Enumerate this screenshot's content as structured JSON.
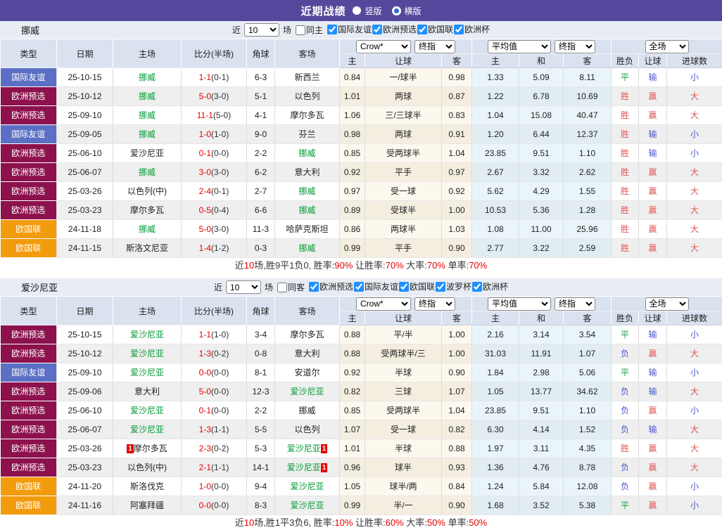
{
  "title_bar": {
    "title": "近期战绩",
    "radio_vertical": "竖版",
    "radio_horizontal": "横版"
  },
  "table_header": {
    "cols": [
      "类型",
      "日期",
      "主场",
      "比分(半场)",
      "角球",
      "客场"
    ],
    "sub": [
      "主",
      "让球",
      "客",
      "主",
      "和",
      "客",
      "胜负",
      "让球",
      "进球数"
    ],
    "selects": {
      "crow": "Crow*",
      "final": "终指",
      "avg": "平均值",
      "full": "全场"
    }
  },
  "type_colors": {
    "国际友谊": "#5b70c4",
    "欧洲预选": "#8c114d",
    "欧国联": "#f29b0d"
  },
  "result_colors": {
    "胜": "#e25555",
    "平": "#18a045",
    "负": "#4a55cc",
    "赢": "#e25555",
    "输": "#4a55cc",
    "大": "#e25555",
    "小": "#4a55cc"
  },
  "sections": [
    {
      "team": "挪威",
      "filter": {
        "near": "近",
        "count": "10",
        "games": "场",
        "same": "同主",
        "leagues": [
          "国际友谊",
          "欧洲预选",
          "欧国联",
          "欧洲杯"
        ]
      },
      "rows": [
        {
          "type": "国际友谊",
          "date": "25-10-15",
          "home": "挪威",
          "home_rc": "",
          "score": "1-1",
          "half": "(0-1)",
          "corner": "6-3",
          "away": "新西兰",
          "away_rc": "",
          "odds": [
            "0.84",
            "一/球半",
            "0.98"
          ],
          "avg": [
            "1.33",
            "5.09",
            "8.11"
          ],
          "res": [
            "平",
            "输",
            "小"
          ]
        },
        {
          "type": "欧洲预选",
          "date": "25-10-12",
          "home": "挪威",
          "home_rc": "",
          "score": "5-0",
          "half": "(3-0)",
          "corner": "5-1",
          "away": "以色列",
          "away_rc": "",
          "odds": [
            "1.01",
            "两球",
            "0.87"
          ],
          "avg": [
            "1.22",
            "6.78",
            "10.69"
          ],
          "res": [
            "胜",
            "赢",
            "大"
          ]
        },
        {
          "type": "欧洲预选",
          "date": "25-09-10",
          "home": "挪威",
          "home_rc": "",
          "score": "11-1",
          "half": "(5-0)",
          "corner": "4-1",
          "away": "摩尔多瓦",
          "away_rc": "",
          "odds": [
            "1.06",
            "三/三球半",
            "0.83"
          ],
          "avg": [
            "1.04",
            "15.08",
            "40.47"
          ],
          "res": [
            "胜",
            "赢",
            "大"
          ]
        },
        {
          "type": "国际友谊",
          "date": "25-09-05",
          "home": "挪威",
          "home_rc": "",
          "score": "1-0",
          "half": "(1-0)",
          "corner": "9-0",
          "away": "芬兰",
          "away_rc": "",
          "odds": [
            "0.98",
            "两球",
            "0.91"
          ],
          "avg": [
            "1.20",
            "6.44",
            "12.37"
          ],
          "res": [
            "胜",
            "输",
            "小"
          ]
        },
        {
          "type": "欧洲预选",
          "date": "25-06-10",
          "home": "爱沙尼亚",
          "home_rc": "",
          "score": "0-1",
          "half": "(0-0)",
          "corner": "2-2",
          "away": "挪威",
          "away_rc": "",
          "odds": [
            "0.85",
            "受两球半",
            "1.04"
          ],
          "avg": [
            "23.85",
            "9.51",
            "1.10"
          ],
          "res": [
            "胜",
            "输",
            "小"
          ]
        },
        {
          "type": "欧洲预选",
          "date": "25-06-07",
          "home": "挪威",
          "home_rc": "",
          "score": "3-0",
          "half": "(3-0)",
          "corner": "6-2",
          "away": "意大利",
          "away_rc": "",
          "odds": [
            "0.92",
            "平手",
            "0.97"
          ],
          "avg": [
            "2.67",
            "3.32",
            "2.62"
          ],
          "res": [
            "胜",
            "赢",
            "大"
          ]
        },
        {
          "type": "欧洲预选",
          "date": "25-03-26",
          "home": "以色列(中)",
          "home_rc": "",
          "score": "2-4",
          "half": "(0-1)",
          "corner": "2-7",
          "away": "挪威",
          "away_rc": "",
          "odds": [
            "0.97",
            "受一球",
            "0.92"
          ],
          "avg": [
            "5.62",
            "4.29",
            "1.55"
          ],
          "res": [
            "胜",
            "赢",
            "大"
          ]
        },
        {
          "type": "欧洲预选",
          "date": "25-03-23",
          "home": "摩尔多瓦",
          "home_rc": "",
          "score": "0-5",
          "half": "(0-4)",
          "corner": "6-6",
          "away": "挪威",
          "away_rc": "",
          "odds": [
            "0.89",
            "受球半",
            "1.00"
          ],
          "avg": [
            "10.53",
            "5.36",
            "1.28"
          ],
          "res": [
            "胜",
            "赢",
            "大"
          ]
        },
        {
          "type": "欧国联",
          "date": "24-11-18",
          "home": "挪威",
          "home_rc": "",
          "score": "5-0",
          "half": "(3-0)",
          "corner": "11-3",
          "away": "哈萨克斯坦",
          "away_rc": "",
          "odds": [
            "0.86",
            "两球半",
            "1.03"
          ],
          "avg": [
            "1.08",
            "11.00",
            "25.96"
          ],
          "res": [
            "胜",
            "赢",
            "大"
          ]
        },
        {
          "type": "欧国联",
          "date": "24-11-15",
          "home": "斯洛文尼亚",
          "home_rc": "",
          "score": "1-4",
          "half": "(1-2)",
          "corner": "0-3",
          "away": "挪威",
          "away_rc": "",
          "odds": [
            "0.99",
            "平手",
            "0.90"
          ],
          "avg": [
            "2.77",
            "3.22",
            "2.59"
          ],
          "res": [
            "胜",
            "赢",
            "大"
          ]
        }
      ],
      "summary": [
        {
          "t": "近"
        },
        {
          "t": "10",
          "red": true
        },
        {
          "t": "场,胜9平1负0, 胜率:"
        },
        {
          "t": "90%",
          "red": true
        },
        {
          "t": " 让胜率:"
        },
        {
          "t": "70%",
          "red": true
        },
        {
          "t": " 大率:"
        },
        {
          "t": "70%",
          "red": true
        },
        {
          "t": " 单率:"
        },
        {
          "t": "70%",
          "red": true
        }
      ]
    },
    {
      "team": "爱沙尼亚",
      "filter": {
        "near": "近",
        "count": "10",
        "games": "场",
        "same": "同客",
        "leagues": [
          "欧洲预选",
          "国际友谊",
          "欧国联",
          "波罗杯",
          "欧洲杯"
        ]
      },
      "rows": [
        {
          "type": "欧洲预选",
          "date": "25-10-15",
          "home": "爱沙尼亚",
          "home_rc": "",
          "score": "1-1",
          "half": "(1-0)",
          "corner": "3-4",
          "away": "摩尔多瓦",
          "away_rc": "",
          "odds": [
            "0.88",
            "平/半",
            "1.00"
          ],
          "avg": [
            "2.16",
            "3.14",
            "3.54"
          ],
          "res": [
            "平",
            "输",
            "小"
          ]
        },
        {
          "type": "欧洲预选",
          "date": "25-10-12",
          "home": "爱沙尼亚",
          "home_rc": "",
          "score": "1-3",
          "half": "(0-2)",
          "corner": "0-8",
          "away": "意大利",
          "away_rc": "",
          "odds": [
            "0.88",
            "受两球半/三",
            "1.00"
          ],
          "avg": [
            "31.03",
            "11.91",
            "1.07"
          ],
          "res": [
            "负",
            "赢",
            "大"
          ]
        },
        {
          "type": "国际友谊",
          "date": "25-09-10",
          "home": "爱沙尼亚",
          "home_rc": "",
          "score": "0-0",
          "half": "(0-0)",
          "corner": "8-1",
          "away": "安道尔",
          "away_rc": "",
          "odds": [
            "0.92",
            "半球",
            "0.90"
          ],
          "avg": [
            "1.84",
            "2.98",
            "5.06"
          ],
          "res": [
            "平",
            "输",
            "小"
          ]
        },
        {
          "type": "欧洲预选",
          "date": "25-09-06",
          "home": "意大利",
          "home_rc": "",
          "score": "5-0",
          "half": "(0-0)",
          "corner": "12-3",
          "away": "爱沙尼亚",
          "away_rc": "",
          "odds": [
            "0.82",
            "三球",
            "1.07"
          ],
          "avg": [
            "1.05",
            "13.77",
            "34.62"
          ],
          "res": [
            "负",
            "输",
            "大"
          ]
        },
        {
          "type": "欧洲预选",
          "date": "25-06-10",
          "home": "爱沙尼亚",
          "home_rc": "",
          "score": "0-1",
          "half": "(0-0)",
          "corner": "2-2",
          "away": "挪威",
          "away_rc": "",
          "odds": [
            "0.85",
            "受两球半",
            "1.04"
          ],
          "avg": [
            "23.85",
            "9.51",
            "1.10"
          ],
          "res": [
            "负",
            "赢",
            "小"
          ]
        },
        {
          "type": "欧洲预选",
          "date": "25-06-07",
          "home": "爱沙尼亚",
          "home_rc": "",
          "score": "1-3",
          "half": "(1-1)",
          "corner": "5-5",
          "away": "以色列",
          "away_rc": "",
          "odds": [
            "1.07",
            "受一球",
            "0.82"
          ],
          "avg": [
            "6.30",
            "4.14",
            "1.52"
          ],
          "res": [
            "负",
            "输",
            "大"
          ]
        },
        {
          "type": "欧洲预选",
          "date": "25-03-26",
          "home": "摩尔多瓦",
          "home_rc": "1",
          "score": "2-3",
          "half": "(0-2)",
          "corner": "5-3",
          "away": "爱沙尼亚",
          "away_rc": "1",
          "odds": [
            "1.01",
            "半球",
            "0.88"
          ],
          "avg": [
            "1.97",
            "3.11",
            "4.35"
          ],
          "res": [
            "胜",
            "赢",
            "大"
          ]
        },
        {
          "type": "欧洲预选",
          "date": "25-03-23",
          "home": "以色列(中)",
          "home_rc": "",
          "score": "2-1",
          "half": "(1-1)",
          "corner": "14-1",
          "away": "爱沙尼亚",
          "away_rc": "1",
          "odds": [
            "0.96",
            "球半",
            "0.93"
          ],
          "avg": [
            "1.36",
            "4.76",
            "8.78"
          ],
          "res": [
            "负",
            "赢",
            "大"
          ]
        },
        {
          "type": "欧国联",
          "date": "24-11-20",
          "home": "斯洛伐克",
          "home_rc": "",
          "score": "1-0",
          "half": "(0-0)",
          "corner": "9-4",
          "away": "爱沙尼亚",
          "away_rc": "",
          "odds": [
            "1.05",
            "球半/两",
            "0.84"
          ],
          "avg": [
            "1.24",
            "5.84",
            "12.08"
          ],
          "res": [
            "负",
            "赢",
            "小"
          ]
        },
        {
          "type": "欧国联",
          "date": "24-11-16",
          "home": "阿塞拜疆",
          "home_rc": "",
          "score": "0-0",
          "half": "(0-0)",
          "corner": "8-3",
          "away": "爱沙尼亚",
          "away_rc": "",
          "odds": [
            "0.99",
            "半/一",
            "0.90"
          ],
          "avg": [
            "1.68",
            "3.52",
            "5.38"
          ],
          "res": [
            "平",
            "赢",
            "小"
          ]
        }
      ],
      "summary": [
        {
          "t": "近"
        },
        {
          "t": "10",
          "red": true
        },
        {
          "t": "场,胜1平3负6, 胜率:"
        },
        {
          "t": "10%",
          "red": true
        },
        {
          "t": " 让胜率:"
        },
        {
          "t": "60%",
          "red": true
        },
        {
          "t": " 大率:"
        },
        {
          "t": "50%",
          "red": true
        },
        {
          "t": " 单率:"
        },
        {
          "t": "50%",
          "red": true
        }
      ]
    }
  ]
}
